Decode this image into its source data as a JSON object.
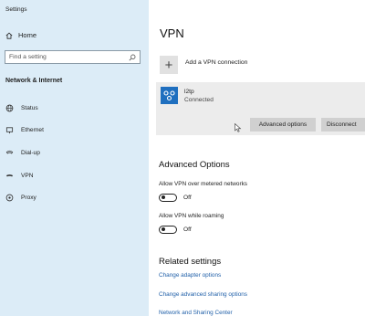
{
  "window": {
    "title": "Settings"
  },
  "sidebar": {
    "home_label": "Home",
    "search_placeholder": "Find a setting",
    "section_title": "Network & Internet",
    "items": [
      {
        "label": "Status",
        "icon": "globe-icon"
      },
      {
        "label": "Ethernet",
        "icon": "ethernet-icon"
      },
      {
        "label": "Dial-up",
        "icon": "dial-up-icon"
      },
      {
        "label": "VPN",
        "icon": "vpn-icon"
      },
      {
        "label": "Proxy",
        "icon": "proxy-icon"
      }
    ]
  },
  "main": {
    "title": "VPN",
    "add_connection_label": "Add a VPN connection",
    "connection": {
      "name": "l2tp",
      "status": "Connected",
      "advanced_button": "Advanced options",
      "disconnect_button": "Disconnect"
    },
    "advanced_heading": "Advanced Options",
    "options": [
      {
        "label": "Allow VPN over metered networks",
        "state": "Off"
      },
      {
        "label": "Allow VPN while roaming",
        "state": "Off"
      }
    ],
    "related_heading": "Related settings",
    "related_links": [
      "Change adapter options",
      "Change advanced sharing options",
      "Network and Sharing Center"
    ]
  },
  "colors": {
    "sidebar_bg": "#dcecf7",
    "accent": "#1f6fbf",
    "link": "#1f5fa8"
  }
}
